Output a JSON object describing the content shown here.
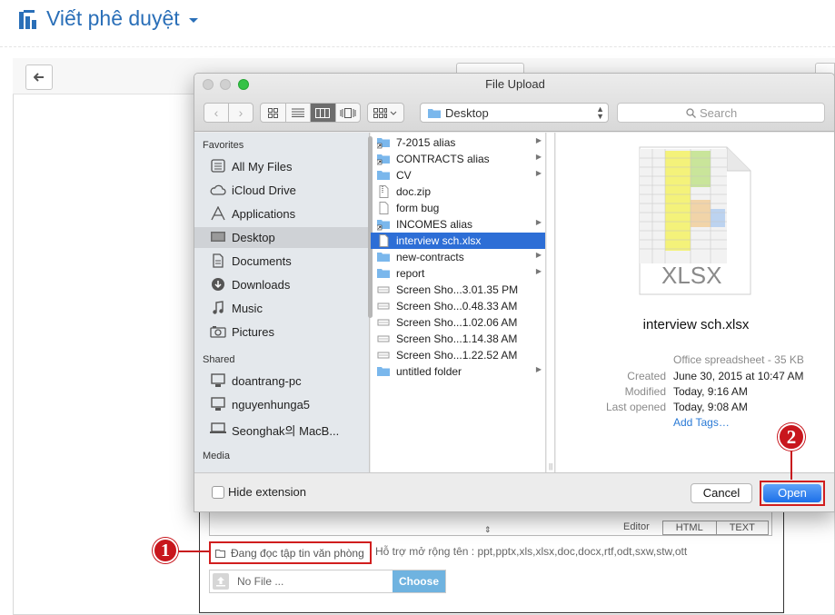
{
  "page": {
    "title": "Viết phê duyệt",
    "editor_tabs": [
      "Editor",
      "HTML",
      "TEXT"
    ],
    "office_link_label": "Đang đọc tập tin văn phòng",
    "support_text": "Hỗ trợ mở rộng tên : ppt,pptx,xls,xlsx,doc,docx,rtf,odt,sxw,stw,ott",
    "file_input_value": "No File ...",
    "choose_label": "Choose",
    "callouts": [
      "1",
      "2"
    ],
    "colors": {
      "title_blue": "#2a6fb8",
      "callout_red": "#c8161d",
      "choose_blue": "#6fb3e0"
    }
  },
  "dialog": {
    "title": "File Upload",
    "location": "Desktop",
    "search_placeholder": "Search",
    "sidebar": {
      "favorites_header": "Favorites",
      "favorites": [
        {
          "label": "All My Files",
          "icon": "all-files-icon"
        },
        {
          "label": "iCloud Drive",
          "icon": "cloud-icon"
        },
        {
          "label": "Applications",
          "icon": "applications-icon"
        },
        {
          "label": "Desktop",
          "icon": "desktop-icon",
          "selected": true
        },
        {
          "label": "Documents",
          "icon": "documents-icon"
        },
        {
          "label": "Downloads",
          "icon": "downloads-icon"
        },
        {
          "label": "Music",
          "icon": "music-icon"
        },
        {
          "label": "Pictures",
          "icon": "pictures-icon"
        }
      ],
      "shared_header": "Shared",
      "shared": [
        {
          "label": "doantrang-pc",
          "icon": "computer-icon"
        },
        {
          "label": "nguyenhunga5",
          "icon": "computer-icon"
        },
        {
          "label": "Seonghak의 MacB...",
          "icon": "laptop-icon"
        }
      ],
      "media_header": "Media"
    },
    "files": [
      {
        "name": "7-2015 alias",
        "kind": "alias-folder",
        "arrow": true
      },
      {
        "name": "CONTRACTS alias",
        "kind": "alias-folder",
        "arrow": true
      },
      {
        "name": "CV",
        "kind": "folder",
        "arrow": true
      },
      {
        "name": "doc.zip",
        "kind": "zip",
        "arrow": false
      },
      {
        "name": "form bug",
        "kind": "document",
        "arrow": false
      },
      {
        "name": "INCOMES alias",
        "kind": "alias-folder",
        "arrow": true
      },
      {
        "name": "interview sch.xlsx",
        "kind": "document",
        "arrow": false,
        "selected": true
      },
      {
        "name": "new-contracts",
        "kind": "folder",
        "arrow": true
      },
      {
        "name": "report",
        "kind": "folder",
        "arrow": true
      },
      {
        "name": "Screen Sho...3.01.35 PM",
        "kind": "screenshot",
        "arrow": false
      },
      {
        "name": "Screen Sho...0.48.33 AM",
        "kind": "screenshot",
        "arrow": false
      },
      {
        "name": "Screen Sho...1.02.06 AM",
        "kind": "screenshot",
        "arrow": false
      },
      {
        "name": "Screen Sho...1.14.38 AM",
        "kind": "screenshot",
        "arrow": false
      },
      {
        "name": "Screen Sho...1.22.52 AM",
        "kind": "screenshot",
        "arrow": false
      },
      {
        "name": "untitled folder",
        "kind": "folder",
        "arrow": true
      }
    ],
    "preview": {
      "name": "interview sch.xlsx",
      "thumb_label": "XLSX",
      "kind": "Office spreadsheet - 35 KB",
      "meta": [
        {
          "label": "Created",
          "value": "June 30, 2015 at 10:47 AM"
        },
        {
          "label": "Modified",
          "value": "Today, 9:16 AM"
        },
        {
          "label": "Last opened",
          "value": "Today, 9:08 AM"
        }
      ],
      "add_tags": "Add Tags…"
    },
    "hide_extension_label": "Hide extension",
    "hide_extension_checked": false,
    "cancel_label": "Cancel",
    "open_label": "Open"
  }
}
